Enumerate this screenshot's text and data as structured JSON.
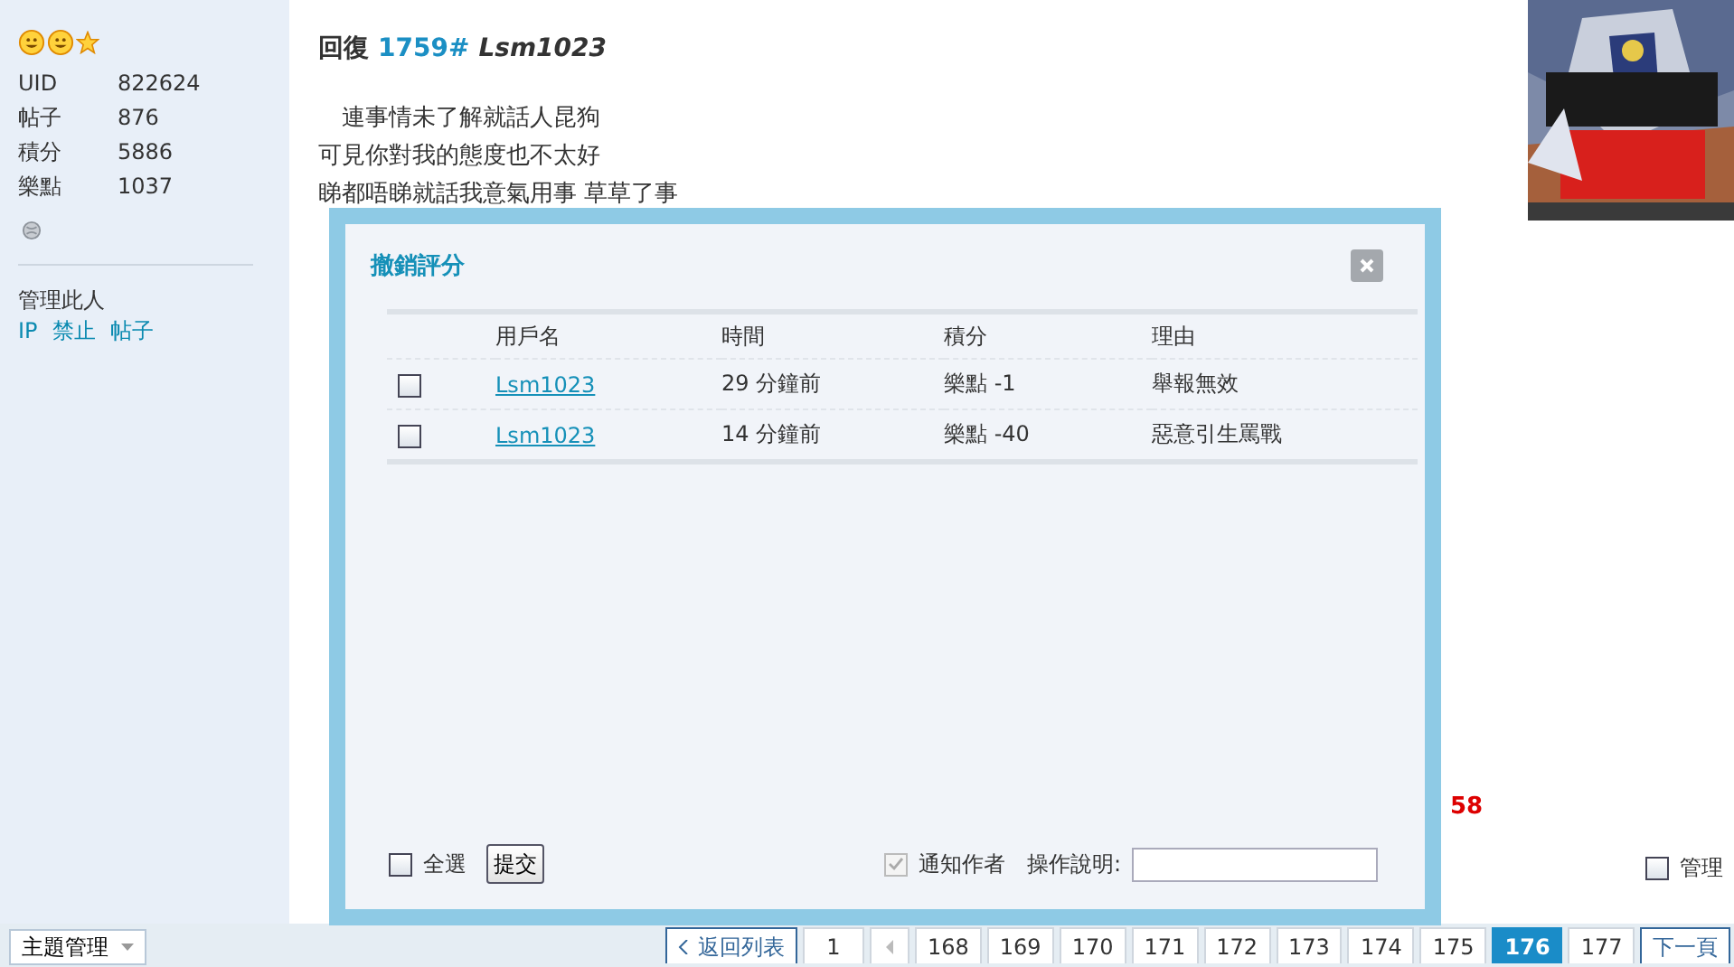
{
  "sidebar": {
    "stats": [
      {
        "label": "UID",
        "value": "822624"
      },
      {
        "label": "帖子",
        "value": "876"
      },
      {
        "label": "積分",
        "value": "5886"
      },
      {
        "label": "樂點",
        "value": "1037"
      }
    ],
    "manage_title": "管理此人",
    "manage_links": [
      "IP",
      "禁止",
      "帖子"
    ]
  },
  "post": {
    "prefix": "回復",
    "floor": "1759#",
    "author": "Lsm1023",
    "lines": [
      "　連事情未了解就話人昆狗",
      "可見你對我的態度也不太好",
      "睇都唔睇就話我意氣用事 草草了事"
    ],
    "score_fragment": "58",
    "manage": {
      "label": "管理",
      "checked": false
    }
  },
  "thread_manage": "主題管理",
  "pagination": {
    "back": "返回列表",
    "first": "1",
    "pages": [
      {
        "label": "168",
        "selected": false
      },
      {
        "label": "169",
        "selected": false
      },
      {
        "label": "170",
        "selected": false
      },
      {
        "label": "171",
        "selected": false
      },
      {
        "label": "172",
        "selected": false
      },
      {
        "label": "173",
        "selected": false
      },
      {
        "label": "174",
        "selected": false
      },
      {
        "label": "175",
        "selected": false
      },
      {
        "label": "176",
        "selected": true
      },
      {
        "label": "177",
        "selected": false
      }
    ],
    "next": "下一頁"
  },
  "dialog": {
    "title": "撤銷評分",
    "columns": [
      "用戶名",
      "時間",
      "積分",
      "理由"
    ],
    "rows": [
      {
        "checked": false,
        "user": "Lsm1023",
        "time": "29 分鐘前",
        "score": "樂點 -1",
        "reason": "舉報無效"
      },
      {
        "checked": false,
        "user": "Lsm1023",
        "time": "14 分鐘前",
        "score": "樂點 -40",
        "reason": "惡意引生罵戰"
      }
    ],
    "select_all": {
      "label": "全選",
      "checked": false
    },
    "submit": "提交",
    "notify": {
      "label": "通知作者",
      "checked": true,
      "disabled": true
    },
    "note_label": "操作說明:"
  }
}
